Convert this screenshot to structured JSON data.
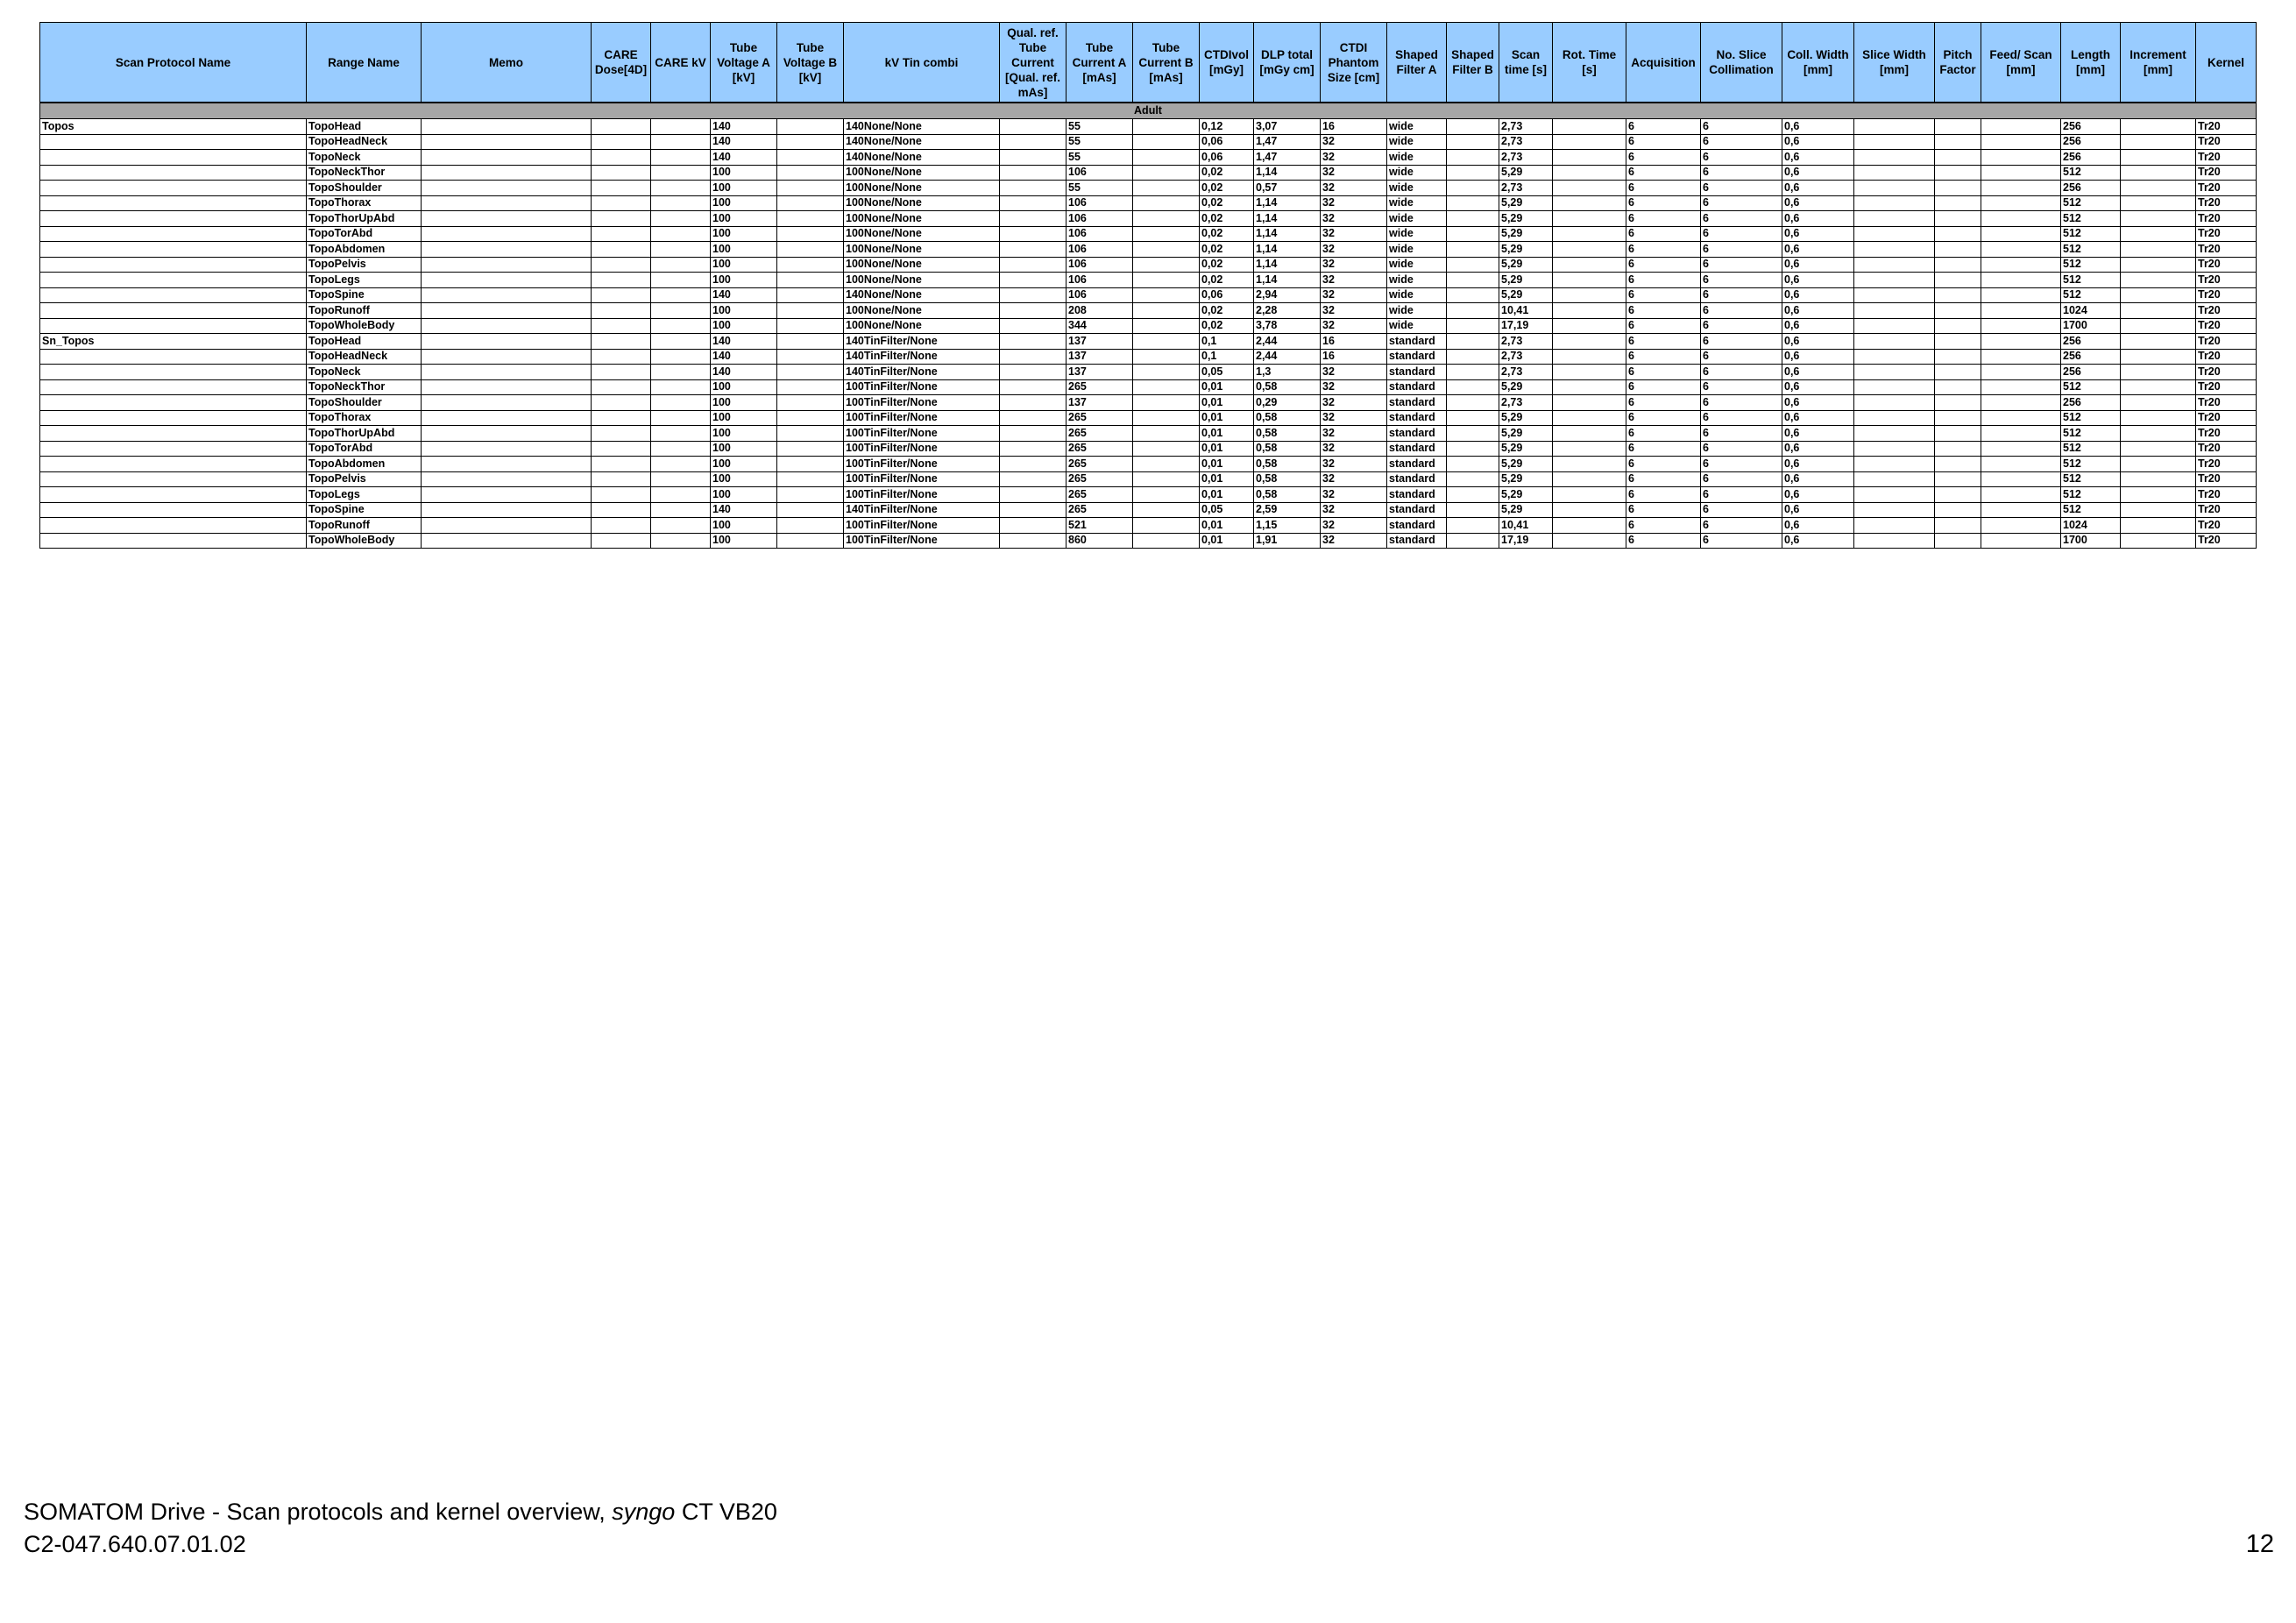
{
  "columns": [
    "Scan Protocol Name",
    "Range Name",
    "Memo",
    "CARE Dose[4D]",
    "CARE kV",
    "Tube Voltage A [kV]",
    "Tube Voltage B [kV]",
    "kV Tin combi",
    "Qual. ref. Tube Current [Qual. ref. mAs]",
    "Tube Current A [mAs]",
    "Tube Current B [mAs]",
    "CTDIvol [mGy]",
    "DLP total [mGy cm]",
    "CTDI Phantom Size [cm]",
    "Shaped Filter A",
    "Shaped Filter B",
    "Scan time [s]",
    "Rot. Time [s]",
    "Acquisition",
    "No. Slice Collimation",
    "Coll. Width [mm]",
    "Slice Width [mm]",
    "Pitch Factor",
    "Feed/ Scan [mm]",
    "Length [mm]",
    "Increment [mm]",
    "Kernel"
  ],
  "section_label": "Adult",
  "rows": [
    [
      "Topos",
      "TopoHead",
      "",
      "",
      "",
      "140",
      "",
      "140None/None",
      "",
      "55",
      "",
      "0,12",
      "3,07",
      "16",
      "wide",
      "",
      "2,73",
      "",
      "6",
      "6",
      "0,6",
      "",
      "",
      "",
      "256",
      "",
      "Tr20"
    ],
    [
      "",
      "TopoHeadNeck",
      "",
      "",
      "",
      "140",
      "",
      "140None/None",
      "",
      "55",
      "",
      "0,06",
      "1,47",
      "32",
      "wide",
      "",
      "2,73",
      "",
      "6",
      "6",
      "0,6",
      "",
      "",
      "",
      "256",
      "",
      "Tr20"
    ],
    [
      "",
      "TopoNeck",
      "",
      "",
      "",
      "140",
      "",
      "140None/None",
      "",
      "55",
      "",
      "0,06",
      "1,47",
      "32",
      "wide",
      "",
      "2,73",
      "",
      "6",
      "6",
      "0,6",
      "",
      "",
      "",
      "256",
      "",
      "Tr20"
    ],
    [
      "",
      "TopoNeckThor",
      "",
      "",
      "",
      "100",
      "",
      "100None/None",
      "",
      "106",
      "",
      "0,02",
      "1,14",
      "32",
      "wide",
      "",
      "5,29",
      "",
      "6",
      "6",
      "0,6",
      "",
      "",
      "",
      "512",
      "",
      "Tr20"
    ],
    [
      "",
      "TopoShoulder",
      "",
      "",
      "",
      "100",
      "",
      "100None/None",
      "",
      "55",
      "",
      "0,02",
      "0,57",
      "32",
      "wide",
      "",
      "2,73",
      "",
      "6",
      "6",
      "0,6",
      "",
      "",
      "",
      "256",
      "",
      "Tr20"
    ],
    [
      "",
      "TopoThorax",
      "",
      "",
      "",
      "100",
      "",
      "100None/None",
      "",
      "106",
      "",
      "0,02",
      "1,14",
      "32",
      "wide",
      "",
      "5,29",
      "",
      "6",
      "6",
      "0,6",
      "",
      "",
      "",
      "512",
      "",
      "Tr20"
    ],
    [
      "",
      "TopoThorUpAbd",
      "",
      "",
      "",
      "100",
      "",
      "100None/None",
      "",
      "106",
      "",
      "0,02",
      "1,14",
      "32",
      "wide",
      "",
      "5,29",
      "",
      "6",
      "6",
      "0,6",
      "",
      "",
      "",
      "512",
      "",
      "Tr20"
    ],
    [
      "",
      "TopoTorAbd",
      "",
      "",
      "",
      "100",
      "",
      "100None/None",
      "",
      "106",
      "",
      "0,02",
      "1,14",
      "32",
      "wide",
      "",
      "5,29",
      "",
      "6",
      "6",
      "0,6",
      "",
      "",
      "",
      "512",
      "",
      "Tr20"
    ],
    [
      "",
      "TopoAbdomen",
      "",
      "",
      "",
      "100",
      "",
      "100None/None",
      "",
      "106",
      "",
      "0,02",
      "1,14",
      "32",
      "wide",
      "",
      "5,29",
      "",
      "6",
      "6",
      "0,6",
      "",
      "",
      "",
      "512",
      "",
      "Tr20"
    ],
    [
      "",
      "TopoPelvis",
      "",
      "",
      "",
      "100",
      "",
      "100None/None",
      "",
      "106",
      "",
      "0,02",
      "1,14",
      "32",
      "wide",
      "",
      "5,29",
      "",
      "6",
      "6",
      "0,6",
      "",
      "",
      "",
      "512",
      "",
      "Tr20"
    ],
    [
      "",
      "TopoLegs",
      "",
      "",
      "",
      "100",
      "",
      "100None/None",
      "",
      "106",
      "",
      "0,02",
      "1,14",
      "32",
      "wide",
      "",
      "5,29",
      "",
      "6",
      "6",
      "0,6",
      "",
      "",
      "",
      "512",
      "",
      "Tr20"
    ],
    [
      "",
      "TopoSpine",
      "",
      "",
      "",
      "140",
      "",
      "140None/None",
      "",
      "106",
      "",
      "0,06",
      "2,94",
      "32",
      "wide",
      "",
      "5,29",
      "",
      "6",
      "6",
      "0,6",
      "",
      "",
      "",
      "512",
      "",
      "Tr20"
    ],
    [
      "",
      "TopoRunoff",
      "",
      "",
      "",
      "100",
      "",
      "100None/None",
      "",
      "208",
      "",
      "0,02",
      "2,28",
      "32",
      "wide",
      "",
      "10,41",
      "",
      "6",
      "6",
      "0,6",
      "",
      "",
      "",
      "1024",
      "",
      "Tr20"
    ],
    [
      "",
      "TopoWholeBody",
      "",
      "",
      "",
      "100",
      "",
      "100None/None",
      "",
      "344",
      "",
      "0,02",
      "3,78",
      "32",
      "wide",
      "",
      "17,19",
      "",
      "6",
      "6",
      "0,6",
      "",
      "",
      "",
      "1700",
      "",
      "Tr20"
    ],
    [
      "Sn_Topos",
      "TopoHead",
      "",
      "",
      "",
      "140",
      "",
      "140TinFilter/None",
      "",
      "137",
      "",
      "0,1",
      "2,44",
      "16",
      "standard",
      "",
      "2,73",
      "",
      "6",
      "6",
      "0,6",
      "",
      "",
      "",
      "256",
      "",
      "Tr20"
    ],
    [
      "",
      "TopoHeadNeck",
      "",
      "",
      "",
      "140",
      "",
      "140TinFilter/None",
      "",
      "137",
      "",
      "0,1",
      "2,44",
      "16",
      "standard",
      "",
      "2,73",
      "",
      "6",
      "6",
      "0,6",
      "",
      "",
      "",
      "256",
      "",
      "Tr20"
    ],
    [
      "",
      "TopoNeck",
      "",
      "",
      "",
      "140",
      "",
      "140TinFilter/None",
      "",
      "137",
      "",
      "0,05",
      "1,3",
      "32",
      "standard",
      "",
      "2,73",
      "",
      "6",
      "6",
      "0,6",
      "",
      "",
      "",
      "256",
      "",
      "Tr20"
    ],
    [
      "",
      "TopoNeckThor",
      "",
      "",
      "",
      "100",
      "",
      "100TinFilter/None",
      "",
      "265",
      "",
      "0,01",
      "0,58",
      "32",
      "standard",
      "",
      "5,29",
      "",
      "6",
      "6",
      "0,6",
      "",
      "",
      "",
      "512",
      "",
      "Tr20"
    ],
    [
      "",
      "TopoShoulder",
      "",
      "",
      "",
      "100",
      "",
      "100TinFilter/None",
      "",
      "137",
      "",
      "0,01",
      "0,29",
      "32",
      "standard",
      "",
      "2,73",
      "",
      "6",
      "6",
      "0,6",
      "",
      "",
      "",
      "256",
      "",
      "Tr20"
    ],
    [
      "",
      "TopoThorax",
      "",
      "",
      "",
      "100",
      "",
      "100TinFilter/None",
      "",
      "265",
      "",
      "0,01",
      "0,58",
      "32",
      "standard",
      "",
      "5,29",
      "",
      "6",
      "6",
      "0,6",
      "",
      "",
      "",
      "512",
      "",
      "Tr20"
    ],
    [
      "",
      "TopoThorUpAbd",
      "",
      "",
      "",
      "100",
      "",
      "100TinFilter/None",
      "",
      "265",
      "",
      "0,01",
      "0,58",
      "32",
      "standard",
      "",
      "5,29",
      "",
      "6",
      "6",
      "0,6",
      "",
      "",
      "",
      "512",
      "",
      "Tr20"
    ],
    [
      "",
      "TopoTorAbd",
      "",
      "",
      "",
      "100",
      "",
      "100TinFilter/None",
      "",
      "265",
      "",
      "0,01",
      "0,58",
      "32",
      "standard",
      "",
      "5,29",
      "",
      "6",
      "6",
      "0,6",
      "",
      "",
      "",
      "512",
      "",
      "Tr20"
    ],
    [
      "",
      "TopoAbdomen",
      "",
      "",
      "",
      "100",
      "",
      "100TinFilter/None",
      "",
      "265",
      "",
      "0,01",
      "0,58",
      "32",
      "standard",
      "",
      "5,29",
      "",
      "6",
      "6",
      "0,6",
      "",
      "",
      "",
      "512",
      "",
      "Tr20"
    ],
    [
      "",
      "TopoPelvis",
      "",
      "",
      "",
      "100",
      "",
      "100TinFilter/None",
      "",
      "265",
      "",
      "0,01",
      "0,58",
      "32",
      "standard",
      "",
      "5,29",
      "",
      "6",
      "6",
      "0,6",
      "",
      "",
      "",
      "512",
      "",
      "Tr20"
    ],
    [
      "",
      "TopoLegs",
      "",
      "",
      "",
      "100",
      "",
      "100TinFilter/None",
      "",
      "265",
      "",
      "0,01",
      "0,58",
      "32",
      "standard",
      "",
      "5,29",
      "",
      "6",
      "6",
      "0,6",
      "",
      "",
      "",
      "512",
      "",
      "Tr20"
    ],
    [
      "",
      "TopoSpine",
      "",
      "",
      "",
      "140",
      "",
      "140TinFilter/None",
      "",
      "265",
      "",
      "0,05",
      "2,59",
      "32",
      "standard",
      "",
      "5,29",
      "",
      "6",
      "6",
      "0,6",
      "",
      "",
      "",
      "512",
      "",
      "Tr20"
    ],
    [
      "",
      "TopoRunoff",
      "",
      "",
      "",
      "100",
      "",
      "100TinFilter/None",
      "",
      "521",
      "",
      "0,01",
      "1,15",
      "32",
      "standard",
      "",
      "10,41",
      "",
      "6",
      "6",
      "0,6",
      "",
      "",
      "",
      "1024",
      "",
      "Tr20"
    ],
    [
      "",
      "TopoWholeBody",
      "",
      "",
      "",
      "100",
      "",
      "100TinFilter/None",
      "",
      "860",
      "",
      "0,01",
      "1,91",
      "32",
      "standard",
      "",
      "17,19",
      "",
      "6",
      "6",
      "0,6",
      "",
      "",
      "",
      "1700",
      "",
      "Tr20"
    ]
  ],
  "footer": {
    "title_prefix": "SOMATOM Drive - Scan protocols and kernel overview, ",
    "title_italic": "syngo",
    "title_suffix": " CT VB20",
    "doc_number": "C2-047.640.07.01.02",
    "page_number": "12"
  }
}
